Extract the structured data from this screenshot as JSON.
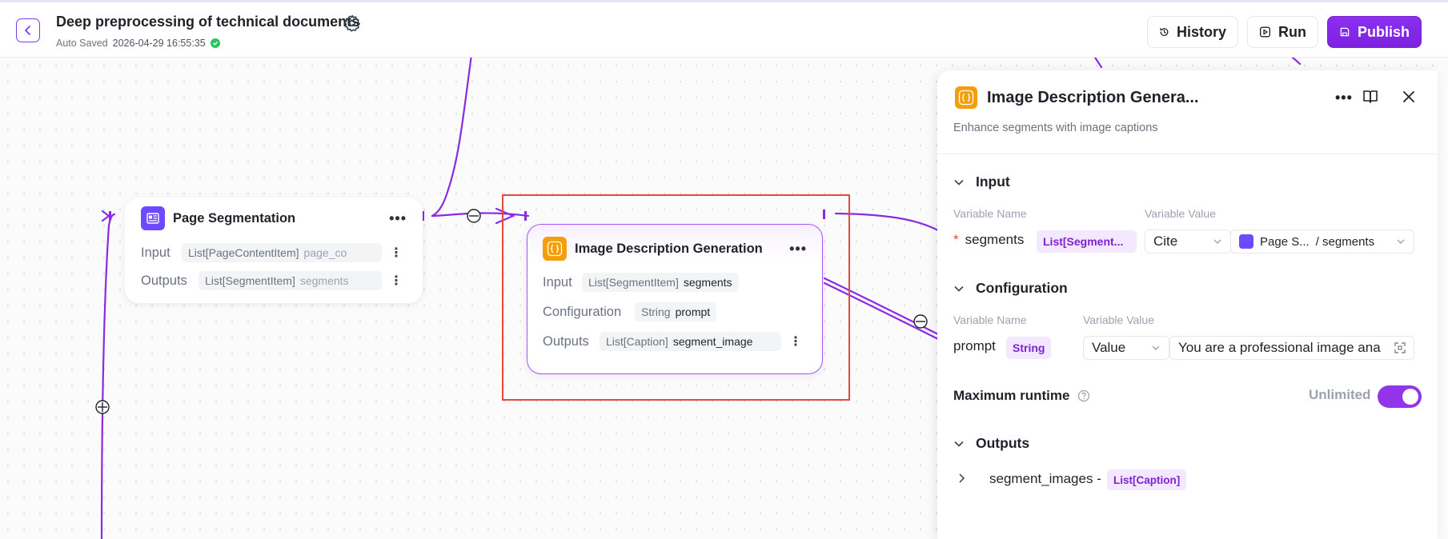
{
  "header": {
    "title": "Deep preprocessing of technical documents",
    "autosave_label": "Auto Saved",
    "autosave_time": "2026-04-29 16:55:35",
    "history_label": "History",
    "run_label": "Run",
    "publish_label": "Publish"
  },
  "colors": {
    "accent": "#7e22ce",
    "edge": "#8a2be2",
    "selection": "#e5483d",
    "success": "#22c55e",
    "node_icon_orange": "#f59e0b",
    "node_icon_purple": "#6d4aff"
  },
  "nodes": {
    "page_segmentation": {
      "title": "Page Segmentation",
      "input_label": "Input",
      "input_type": "List[PageContentItem]",
      "input_var": "page_co",
      "outputs_label": "Outputs",
      "output_type": "List[SegmentItem]",
      "output_var": "segments"
    },
    "image_description": {
      "title": "Image Description Generation",
      "input_label": "Input",
      "input_type": "List[SegmentItem]",
      "input_var": "segments",
      "config_label": "Configuration",
      "config_type": "String",
      "config_var": "prompt",
      "outputs_label": "Outputs",
      "output_type": "List[Caption]",
      "output_var": "segment_image"
    }
  },
  "panel": {
    "title": "Image Description Genera...",
    "subtitle": "Enhance segments with image captions",
    "input": {
      "section_label": "Input",
      "var_name_label": "Variable Name",
      "var_value_label": "Variable Value",
      "required_mark": "*",
      "var_name": "segments",
      "var_type": "List[Segment...",
      "mode": "Cite",
      "source_node": "Page S...",
      "source_path": "/ segments"
    },
    "configuration": {
      "section_label": "Configuration",
      "var_name_label": "Variable Name",
      "var_value_label": "Variable Value",
      "var_name": "prompt",
      "var_type": "String",
      "mode": "Value",
      "value": "You are a professional image ana"
    },
    "runtime": {
      "label": "Maximum runtime",
      "value": "Unlimited",
      "enabled": true
    },
    "outputs": {
      "section_label": "Outputs",
      "var_name": "segment_images -",
      "var_type": "List[Caption]"
    }
  }
}
